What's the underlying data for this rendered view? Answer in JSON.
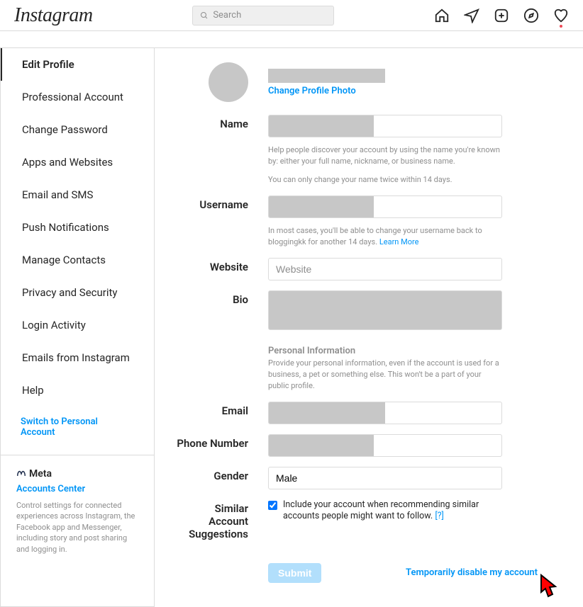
{
  "header": {
    "logo": "Instagram",
    "search_placeholder": "Search"
  },
  "sidebar": {
    "items": [
      "Edit Profile",
      "Professional Account",
      "Change Password",
      "Apps and Websites",
      "Email and SMS",
      "Push Notifications",
      "Manage Contacts",
      "Privacy and Security",
      "Login Activity",
      "Emails from Instagram",
      "Help"
    ],
    "active_index": 0,
    "switch_link": "Switch to Personal Account"
  },
  "meta": {
    "brand": "Meta",
    "link": "Accounts Center",
    "desc": "Control settings for connected experiences across Instagram, the Facebook app and Messenger, including story and post sharing and logging in."
  },
  "main": {
    "change_photo": "Change Profile Photo",
    "labels": {
      "name": "Name",
      "username": "Username",
      "website": "Website",
      "bio": "Bio",
      "email": "Email",
      "phone": "Phone Number",
      "gender": "Gender",
      "similar": "Similar Account Suggestions"
    },
    "name_help1": "Help people discover your account by using the name you're known by: either your full name, nickname, or business name.",
    "name_help2": "You can only change your name twice within 14 days.",
    "username_help": "In most cases, you'll be able to change your username back to bloggingkk for another 14 days. ",
    "learn_more": "Learn More",
    "website_placeholder": "Website",
    "personal_h": "Personal Information",
    "personal_desc": "Provide your personal information, even if the account is used for a business, a pet or something else. This won't be a part of your public profile.",
    "gender_value": "Male",
    "similar_text": "Include your account when recommending similar accounts people might want to follow.  ",
    "similar_hint": "[?]",
    "submit": "Submit",
    "disable": "Temporarily disable my account"
  }
}
